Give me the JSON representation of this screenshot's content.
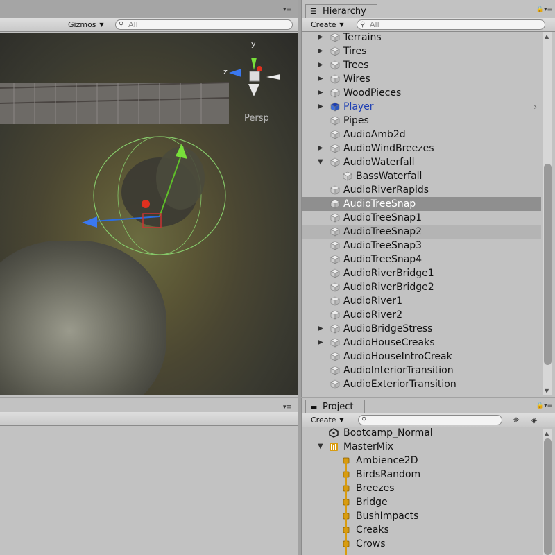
{
  "scene": {
    "gizmos_label": "Gizmos",
    "search_placeholder": "All",
    "perspective_label": "Persp",
    "axis_y": "y",
    "axis_z": "z"
  },
  "hierarchy": {
    "tab_label": "Hierarchy",
    "create_label": "Create",
    "search_placeholder": "All",
    "items": [
      {
        "label": "Terrains",
        "expand": "collapsed",
        "depth": 0
      },
      {
        "label": "Tires",
        "expand": "collapsed",
        "depth": 0
      },
      {
        "label": "Trees",
        "expand": "collapsed",
        "depth": 0
      },
      {
        "label": "Wires",
        "expand": "collapsed",
        "depth": 0
      },
      {
        "label": "WoodPieces",
        "expand": "collapsed",
        "depth": 0
      },
      {
        "label": "Player",
        "expand": "collapsed",
        "depth": 0,
        "prefab": true
      },
      {
        "label": "Pipes",
        "expand": "none",
        "depth": 0
      },
      {
        "label": "AudioAmb2d",
        "expand": "none",
        "depth": 0
      },
      {
        "label": "AudioWindBreezes",
        "expand": "collapsed",
        "depth": 0
      },
      {
        "label": "AudioWaterfall",
        "expand": "expanded",
        "depth": 0
      },
      {
        "label": "BassWaterfall",
        "expand": "none",
        "depth": 1
      },
      {
        "label": "AudioRiverRapids",
        "expand": "none",
        "depth": 0
      },
      {
        "label": "AudioTreeSnap",
        "expand": "none",
        "depth": 0,
        "state": "selected"
      },
      {
        "label": "AudioTreeSnap1",
        "expand": "none",
        "depth": 0
      },
      {
        "label": "AudioTreeSnap2",
        "expand": "none",
        "depth": 0,
        "state": "hovered"
      },
      {
        "label": "AudioTreeSnap3",
        "expand": "none",
        "depth": 0
      },
      {
        "label": "AudioTreeSnap4",
        "expand": "none",
        "depth": 0
      },
      {
        "label": "AudioRiverBridge1",
        "expand": "none",
        "depth": 0
      },
      {
        "label": "AudioRiverBridge2",
        "expand": "none",
        "depth": 0
      },
      {
        "label": "AudioRiver1",
        "expand": "none",
        "depth": 0
      },
      {
        "label": "AudioRiver2",
        "expand": "none",
        "depth": 0
      },
      {
        "label": "AudioBridgeStress",
        "expand": "collapsed",
        "depth": 0
      },
      {
        "label": "AudioHouseCreaks",
        "expand": "collapsed",
        "depth": 0
      },
      {
        "label": "AudioHouseIntroCreak",
        "expand": "none",
        "depth": 0
      },
      {
        "label": "AudioInteriorTransition",
        "expand": "none",
        "depth": 0
      },
      {
        "label": "AudioExteriorTransition",
        "expand": "none",
        "depth": 0
      }
    ]
  },
  "project": {
    "tab_label": "Project",
    "create_label": "Create",
    "search_placeholder": "",
    "items": [
      {
        "label": "Bootcamp_Normal",
        "kind": "unity",
        "depth": 0,
        "expand": "none"
      },
      {
        "label": "MasterMix",
        "kind": "mixer",
        "depth": 0,
        "expand": "expanded"
      },
      {
        "label": "Ambience2D",
        "kind": "group",
        "depth": 1,
        "expand": "none"
      },
      {
        "label": "BirdsRandom",
        "kind": "group",
        "depth": 1,
        "expand": "none"
      },
      {
        "label": "Breezes",
        "kind": "group",
        "depth": 1,
        "expand": "none"
      },
      {
        "label": "Bridge",
        "kind": "group",
        "depth": 1,
        "expand": "none"
      },
      {
        "label": "BushImpacts",
        "kind": "group",
        "depth": 1,
        "expand": "none"
      },
      {
        "label": "Creaks",
        "kind": "group",
        "depth": 1,
        "expand": "none"
      },
      {
        "label": "Crows",
        "kind": "group",
        "depth": 1,
        "expand": "none"
      }
    ]
  },
  "colors": {
    "selected_row": "#8f8f8f",
    "prefab_text": "#1e3fb3",
    "mixer_orange": "#d89c10"
  }
}
